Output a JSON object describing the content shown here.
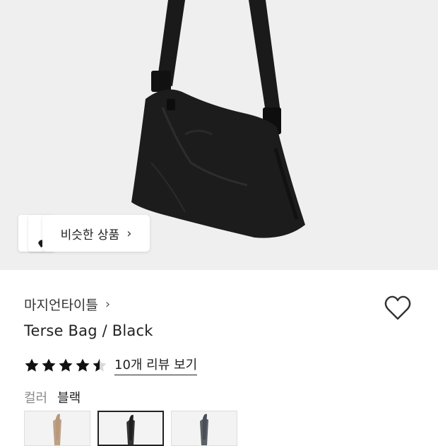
{
  "product": {
    "brand": "마지언타이틀",
    "name": "Terse Bag / Black",
    "rating": 4.5,
    "rating_max": 5,
    "review_link": "10개 리뷰 보기",
    "color_label": "컬러",
    "color_value": "블랙"
  },
  "similar_products": {
    "label": "비슷한 상품"
  },
  "swatches": [
    {
      "name": "beige",
      "color": "#b8977a",
      "selected": false
    },
    {
      "name": "black",
      "color": "#1e1e1e",
      "selected": true
    },
    {
      "name": "grey",
      "color": "#4a4f57",
      "selected": false
    }
  ],
  "colors": {
    "hero_bg": "#efefef",
    "bag": "#1c1c1c",
    "star": "#111111"
  },
  "icons": {
    "heart": "heart-outline-icon",
    "chevron": "chevron-right-icon",
    "star": "star-icon"
  }
}
